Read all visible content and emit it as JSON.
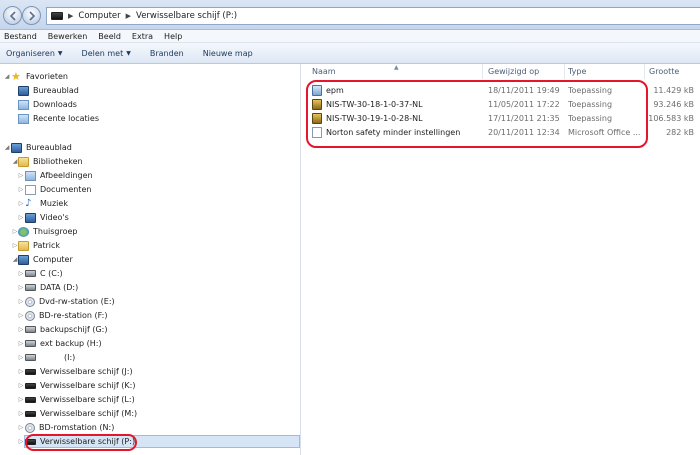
{
  "address": {
    "segments": [
      "Computer",
      "Verwisselbare schijf (P:)"
    ]
  },
  "menubar": {
    "items": [
      "Bestand",
      "Bewerken",
      "Beeld",
      "Extra",
      "Help"
    ]
  },
  "toolbar": {
    "organize": "Organiseren",
    "share": "Delen met",
    "burn": "Branden",
    "new_folder": "Nieuwe map"
  },
  "nav": {
    "favorites": "Favorieten",
    "fav_items": [
      "Bureaublad",
      "Downloads",
      "Recente locaties"
    ],
    "desktop": "Bureaublad",
    "libraries": "Bibliotheken",
    "lib_items": [
      "Afbeeldingen",
      "Documenten",
      "Muziek",
      "Video's"
    ],
    "homegroup": "Thuisgroep",
    "user": "Patrick",
    "computer": "Computer",
    "drives": [
      "C (C:)",
      "DATA (D:)",
      "Dvd-rw-station (E:)",
      "BD-re-station (F:)",
      "backupschijf (G:)",
      "ext backup (H:)",
      "(I:)",
      "Verwisselbare schijf (J:)",
      "Verwisselbare schijf (K:)",
      "Verwisselbare schijf (L:)",
      "Verwisselbare schijf (M:)",
      "BD-romstation (N:)",
      "Verwisselbare schijf (P:)"
    ]
  },
  "columns": {
    "name": "Naam",
    "modified": "Gewijzigd op",
    "type": "Type",
    "size": "Grootte"
  },
  "files": [
    {
      "name": "epm",
      "modified": "18/11/2011 19:49",
      "type": "Toepassing",
      "size": "11.429 kB"
    },
    {
      "name": "NIS-TW-30-18-1-0-37-NL",
      "modified": "11/05/2011 17:22",
      "type": "Toepassing",
      "size": "93.246 kB"
    },
    {
      "name": "NIS-TW-30-19-1-0-28-NL",
      "modified": "17/11/2011 21:35",
      "type": "Toepassing",
      "size": "106.583 kB"
    },
    {
      "name": "Norton safety minder instellingen",
      "modified": "20/11/2011 12:34",
      "type": "Microsoft Office ...",
      "size": "282 kB"
    }
  ],
  "colors": {
    "annotation": "#e3162b",
    "selection": "#d6e5f5",
    "toolbar_text": "#1e395b"
  }
}
